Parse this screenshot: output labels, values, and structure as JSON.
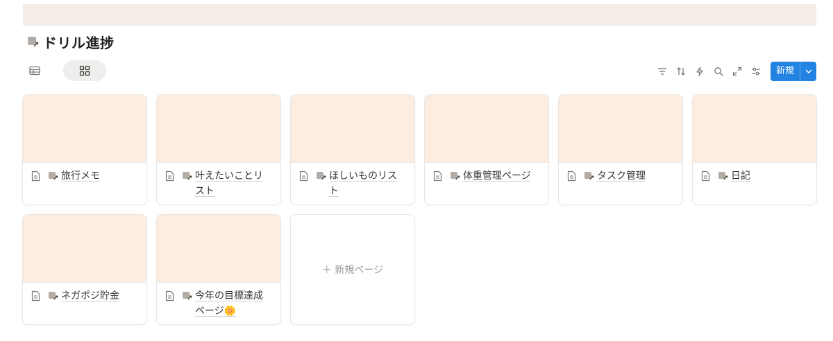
{
  "page": {
    "title": "ドリル進捗",
    "banner_color": "#f4ece7"
  },
  "views": [
    {
      "icon": "table-icon",
      "active": false
    },
    {
      "icon": "gallery-icon",
      "active": true
    }
  ],
  "toolbar": {
    "tools": [
      "filter-icon",
      "sort-icon",
      "automation-icon",
      "search-icon",
      "expand-icon",
      "settings-icon"
    ],
    "new_label": "新規",
    "accent": "#2383e2"
  },
  "cards": [
    {
      "name": "旅行メモ"
    },
    {
      "name": "叶えたいことリスト"
    },
    {
      "name": "ほしいものリスト"
    },
    {
      "name": "体重管理ページ"
    },
    {
      "name": "タスク管理"
    },
    {
      "name": "日記"
    },
    {
      "name": "ネガポジ貯金"
    },
    {
      "name": "今年の目標達成ページ🌼"
    }
  ],
  "new_page_label": "＋ 新規ページ",
  "cover_color": "#fdece0"
}
